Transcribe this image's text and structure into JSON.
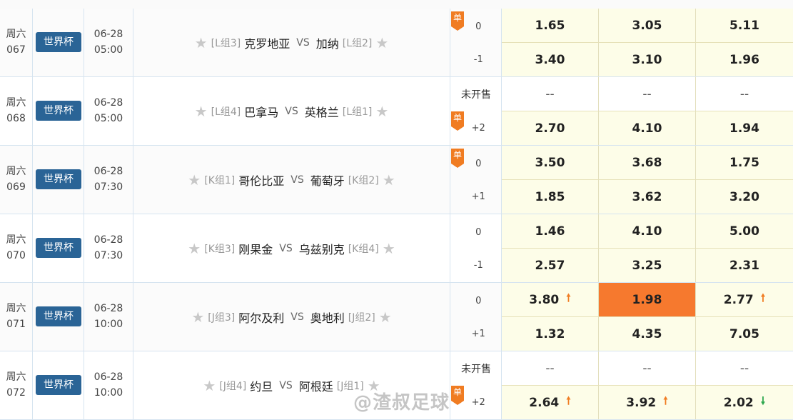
{
  "colors": {
    "league_badge": "#2a6496",
    "dan_badge": "#f07c22",
    "odds_yellow": "#fdfde8",
    "highlight": "#f6792e",
    "arrow_up": "#f07c22",
    "arrow_down": "#2fa84f"
  },
  "watermark": "@渣叔足球",
  "matches": [
    {
      "day": "周六",
      "num": "067",
      "league": "世界杯",
      "date": "06-28",
      "time": "05:00",
      "home_group": "[L组3]",
      "home": "克罗地亚",
      "vs": "VS",
      "away": "加纳",
      "away_group": "[L组2]",
      "line1": "0",
      "line2": "-1",
      "dan_badge": "单",
      "odds1": [
        "1.65",
        "3.05",
        "5.11"
      ],
      "odds2": [
        "3.40",
        "3.10",
        "1.96"
      ]
    },
    {
      "day": "周六",
      "num": "068",
      "league": "世界杯",
      "date": "06-28",
      "time": "05:00",
      "home_group": "[L组4]",
      "home": "巴拿马",
      "vs": "VS",
      "away": "英格兰",
      "away_group": "[L组1]",
      "line1": "未开售",
      "line2": "+2",
      "dan_badge": "单",
      "odds1": [
        "--",
        "--",
        "--"
      ],
      "odds2": [
        "2.70",
        "4.10",
        "1.94"
      ]
    },
    {
      "day": "周六",
      "num": "069",
      "league": "世界杯",
      "date": "06-28",
      "time": "07:30",
      "home_group": "[K组1]",
      "home": "哥伦比亚",
      "vs": "VS",
      "away": "葡萄牙",
      "away_group": "[K组2]",
      "line1": "0",
      "line2": "+1",
      "dan_badge": "单",
      "odds1": [
        "3.50",
        "3.68",
        "1.75"
      ],
      "odds2": [
        "1.85",
        "3.62",
        "3.20"
      ]
    },
    {
      "day": "周六",
      "num": "070",
      "league": "世界杯",
      "date": "06-28",
      "time": "07:30",
      "home_group": "[K组3]",
      "home": "刚果金",
      "vs": "VS",
      "away": "乌兹别克",
      "away_group": "[K组4]",
      "line1": "0",
      "line2": "-1",
      "odds1": [
        "1.46",
        "4.10",
        "5.00"
      ],
      "odds2": [
        "2.57",
        "3.25",
        "2.31"
      ]
    },
    {
      "day": "周六",
      "num": "071",
      "league": "世界杯",
      "date": "06-28",
      "time": "10:00",
      "home_group": "[J组3]",
      "home": "阿尔及利",
      "vs": "VS",
      "away": "奥地利",
      "away_group": "[J组2]",
      "line1": "0",
      "line2": "+1",
      "odds1": [
        "3.80",
        "1.98",
        "2.77"
      ],
      "odds2": [
        "1.32",
        "4.35",
        "7.05"
      ],
      "trend1": [
        "up",
        "",
        "up"
      ],
      "highlight1": 1
    },
    {
      "day": "周六",
      "num": "072",
      "league": "世界杯",
      "date": "06-28",
      "time": "10:00",
      "home_group": "[J组4]",
      "home": "约旦",
      "vs": "VS",
      "away": "阿根廷",
      "away_group": "[J组1]",
      "line1": "未开售",
      "line2": "+2",
      "dan_badge": "单",
      "odds1": [
        "--",
        "--",
        "--"
      ],
      "odds2": [
        "2.64",
        "3.92",
        "2.02"
      ],
      "trend2": [
        "up",
        "up",
        "down"
      ]
    }
  ]
}
